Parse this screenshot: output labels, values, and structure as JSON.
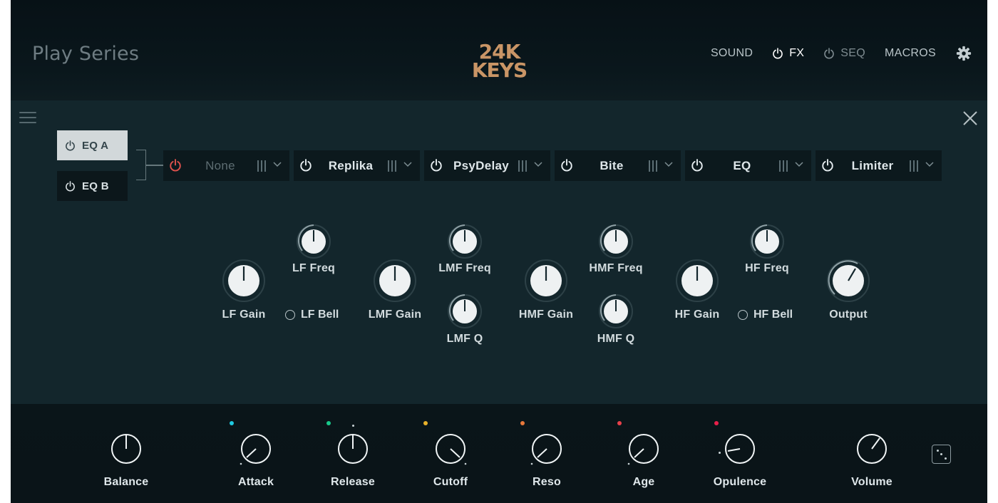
{
  "header": {
    "brand": "Play Series",
    "logo_line1": "24K",
    "logo_line2": "KEYS",
    "nav": [
      {
        "label": "SOUND",
        "power": false,
        "state": "normal"
      },
      {
        "label": "FX",
        "power": true,
        "state": "active"
      },
      {
        "label": "SEQ",
        "power": true,
        "state": "dim"
      },
      {
        "label": "MACROS",
        "power": false,
        "state": "normal"
      }
    ]
  },
  "fx": {
    "eq_a": "EQ A",
    "eq_b": "EQ B",
    "slots": [
      {
        "name": "None",
        "active": false
      },
      {
        "name": "Replika",
        "active": true
      },
      {
        "name": "PsyDelay",
        "active": true
      },
      {
        "name": "Bite",
        "active": true
      },
      {
        "name": "EQ",
        "active": true
      },
      {
        "name": "Limiter",
        "active": true
      }
    ],
    "knobs": {
      "lf_gain": "LF Gain",
      "lf_freq": "LF Freq",
      "lf_bell": "LF Bell",
      "lmf_gain": "LMF Gain",
      "lmf_freq": "LMF Freq",
      "lmf_q": "LMF Q",
      "hmf_gain": "HMF Gain",
      "hmf_freq": "HMF Freq",
      "hmf_q": "HMF Q",
      "hf_gain": "HF Gain",
      "hf_freq": "HF Freq",
      "hf_bell": "HF Bell",
      "output": "Output"
    }
  },
  "footer": {
    "balance": "Balance",
    "attack": "Attack",
    "release": "Release",
    "cutoff": "Cutoff",
    "reso": "Reso",
    "age": "Age",
    "opulence": "Opulence",
    "volume": "Volume"
  },
  "colors": {
    "accent_logo": "#c99566",
    "power_off_red": "#e0524d",
    "dot_attack": "#1fc9e0",
    "dot_release": "#18c98a",
    "dot_cutoff": "#e8b12a",
    "dot_reso": "#e8783a",
    "dot_age": "#e8404a",
    "dot_opulence": "#e8204a"
  }
}
